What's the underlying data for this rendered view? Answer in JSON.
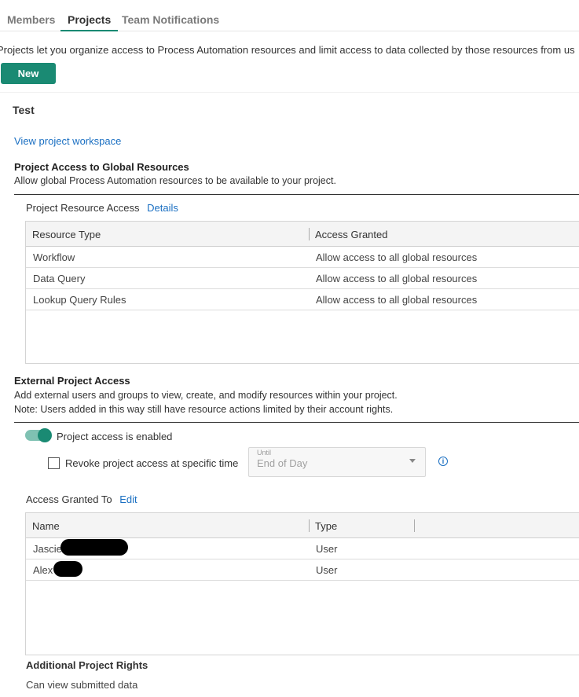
{
  "tabs": [
    {
      "label": "Members",
      "active": false
    },
    {
      "label": "Projects",
      "active": true
    },
    {
      "label": "Team Notifications",
      "active": false
    }
  ],
  "intro_text": "Projects let you organize access to Process Automation resources and limit access to data collected by those resources from us",
  "new_button": "New",
  "project": {
    "title": "Test",
    "workspace_link": "View project workspace"
  },
  "global_access": {
    "heading": "Project Access to Global Resources",
    "description": "Allow global Process Automation resources to be available to your project.",
    "sub_heading": "Project Resource Access",
    "details_link": "Details",
    "columns": [
      "Resource Type",
      "Access Granted"
    ],
    "rows": [
      {
        "type": "Workflow",
        "access": "Allow access to all global resources"
      },
      {
        "type": "Data Query",
        "access": "Allow access to all global resources"
      },
      {
        "type": "Lookup Query Rules",
        "access": "Allow access to all global resources"
      }
    ]
  },
  "external_access": {
    "heading": "External Project Access",
    "description_1": "Add external users and groups to view, create, and modify resources within your project.",
    "description_2": "Note: Users added in this way still have resource actions limited by their account rights.",
    "toggle_label": "Project access is enabled",
    "toggle_on": true,
    "revoke_label": "Revoke project access at specific time",
    "revoke_checked": false,
    "until_label": "Until",
    "until_value": "End of Day",
    "info_icon": "info-circle-icon"
  },
  "access_granted": {
    "heading": "Access Granted To",
    "edit_link": "Edit",
    "columns": [
      "Name",
      "Type"
    ],
    "rows": [
      {
        "name": "Jasciel",
        "type": "User"
      },
      {
        "name": "Alex",
        "type": "User"
      }
    ]
  },
  "rights": {
    "heading": "Additional Project Rights",
    "items": [
      "Can view submitted data"
    ]
  },
  "colors": {
    "accent": "#1a8a73",
    "link": "#1a6fc2"
  }
}
